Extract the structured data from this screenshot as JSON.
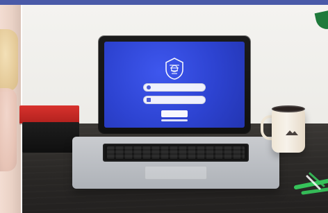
{
  "scene": {
    "subject": "laptop-on-desk",
    "screen_ui": "login-form"
  },
  "colors": {
    "topbar": "#4a5aa8",
    "screen_blue": "#2d43d1",
    "screen_blue_light": "#3e57ee",
    "wall": "#f0efec",
    "desk": "#2f2c2a",
    "book_red": "#c72a26",
    "book_black": "#141414",
    "laptop_silver": "#b9bdc3",
    "mug_enamel": "#efe6d6",
    "pen_green": "#36c25a"
  },
  "icons": {
    "logo": "shield-logo-icon",
    "user_field": "user-icon",
    "password_field": "lock-icon",
    "mug_mark": "mountain-icon"
  }
}
